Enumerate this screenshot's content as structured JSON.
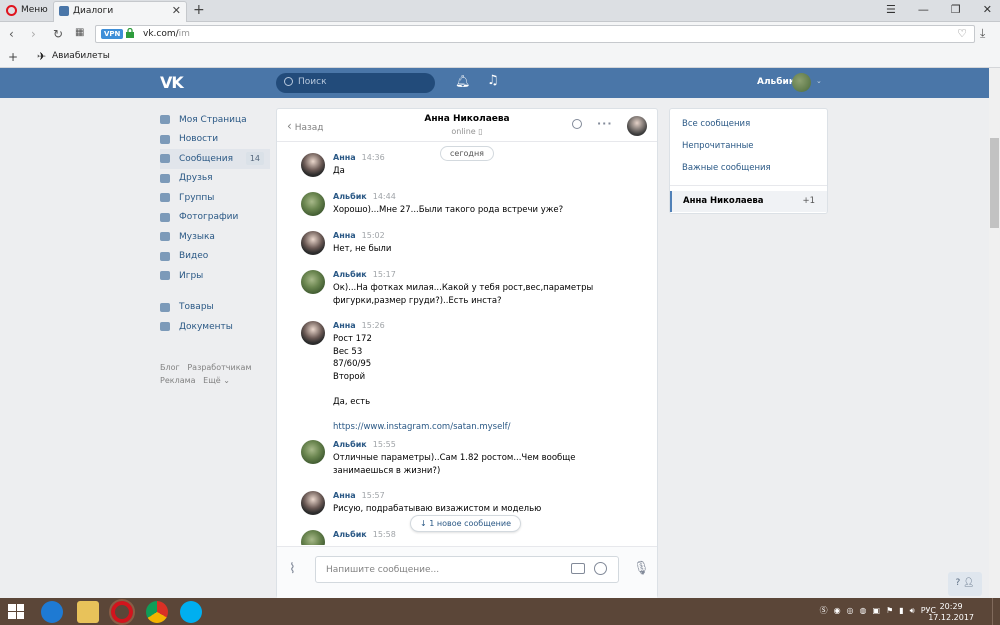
{
  "browser": {
    "menu_label": "Меню",
    "tab_title": "Диалоги",
    "url_main": "vk.com/",
    "url_path": "im",
    "vpn_label": "VPN",
    "bookmark": "Авиабилеты"
  },
  "vk_header": {
    "logo": "VK",
    "search_placeholder": "Поиск",
    "user_name": "Альбик"
  },
  "left_nav": {
    "items": [
      {
        "label": "Моя Страница"
      },
      {
        "label": "Новости"
      },
      {
        "label": "Сообщения",
        "badge": "14"
      },
      {
        "label": "Друзья"
      },
      {
        "label": "Группы"
      },
      {
        "label": "Фотографии"
      },
      {
        "label": "Музыка"
      },
      {
        "label": "Видео"
      },
      {
        "label": "Игры"
      },
      {
        "label": "Товары"
      },
      {
        "label": "Документы"
      }
    ],
    "footer": {
      "blog": "Блог",
      "dev": "Разработчикам",
      "ads": "Реклама",
      "more": "Ещё ⌄"
    }
  },
  "chat": {
    "back": "Назад",
    "peer_name": "Анна Николаева",
    "peer_status": "online",
    "date_pill": "сегодня",
    "new_messages": "↓  1 новое сообщение",
    "input_placeholder": "Напишите сообщение...",
    "messages": [
      {
        "author": "Анна",
        "time": "14:36",
        "text": "Да"
      },
      {
        "author": "Альбик",
        "time": "14:44",
        "text": "Хорошо)...Мне 27...Были такого рода встречи уже?"
      },
      {
        "author": "Анна",
        "time": "15:02",
        "text": "Нет, не были"
      },
      {
        "author": "Альбик",
        "time": "15:17",
        "text": "Ок)...На фотках милая...Какой у тебя рост,вес,параметры\nфигурки,размер груди?)..Есть инста?"
      },
      {
        "author": "Анна",
        "time": "15:26",
        "text": "Рост 172\nВес 53\n87/60/95\nВторой\n\nДа, есть\n\n",
        "link": "https://www.instagram.com/satan.myself/"
      },
      {
        "author": "Альбик",
        "time": "15:55",
        "text": "Отличные параметры)..Сам 1.82 ростом...Чем вообще\nзанимаешься в жизни?)"
      },
      {
        "author": "Анна",
        "time": "15:57",
        "text": "Рисую, подрабатываю визажистом и моделью"
      },
      {
        "author": "Альбик",
        "time": "15:58",
        "text": ""
      }
    ]
  },
  "right_panel": {
    "all": "Все сообщения",
    "unread": "Непрочитанные",
    "important": "Важные сообщения",
    "active_name": "Анна Николаева",
    "active_count": "+1"
  },
  "help": "?",
  "taskbar": {
    "lang": "РУС",
    "time": "20:29",
    "date": "17.12.2017"
  }
}
